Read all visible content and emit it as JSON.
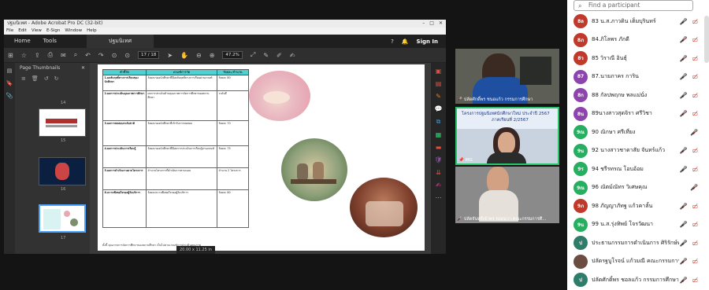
{
  "acrobat": {
    "window_title": "ปฐมนิเทศ - Adobe Acrobat Pro DC (32-bit)",
    "menu": [
      "File",
      "Edit",
      "View",
      "E-Sign",
      "Window",
      "Help"
    ],
    "tabs": {
      "home": "Home",
      "tools": "Tools",
      "doc": "ปฐมนิเทศ"
    },
    "sign_in": "Sign In",
    "page_current": "17",
    "page_total": "/ 18",
    "zoom": "47.2%",
    "panel_title": "Page Thumbnails",
    "thumb_numbers": [
      "14",
      "15",
      "16",
      "17"
    ],
    "page_size": "20.00 x 11.25 in"
  },
  "page_content": {
    "headers": [
      "ตัวชี้วัด",
      "เกณฑ์การวัด",
      "ร้อยละ/จำนวน"
    ],
    "rows": [
      {
        "label": "1.ผลสัมฤทธิ์ทางการเรียนของนักศึกษา",
        "criteria": "ร้อยละของนักศึกษาที่มีผลสัมฤทธิ์ทางการเรียนผ่านเกณฑ์",
        "value": "ร้อยละ 80"
      },
      {
        "label": "2.ผลการประเมินคุณภาพการศึกษา",
        "criteria": "ผลการประเมินด้านคุณภาพการจัดการศึกษาของสถานศึกษา",
        "value": "ระดับดี"
      },
      {
        "label": "3.ผลการทดสอบระดับชาติ",
        "criteria": "ร้อยละของนักศึกษาที่เข้ารับการทดสอบ",
        "value": "ร้อยละ 70"
      },
      {
        "label": "4.ผลการประเมินการเรียนรู้",
        "criteria": "ร้อยละของนักศึกษาที่มีผลการประเมินการเรียนรู้ผ่านเกณฑ์",
        "value": "ร้อยละ 75"
      },
      {
        "label": "5.ผลการดำเนินงานตามโครงการ",
        "criteria": "จำนวนโครงการที่ดำเนินการตามแผน",
        "value": "จำนวน 2 โครงการ"
      },
      {
        "label": "6.ความพึงพอใจของผู้รับบริการ",
        "criteria": "ร้อยละความพึงพอใจของผู้รับบริการ",
        "value": "ร้อยละ 80"
      }
    ],
    "footnote": "ทั้งนี้ คุณภาพการจัดการศึกษาของสถานศึกษา เป็นไปตามเกณฑ์การประเมินคุณภาพ"
  },
  "video_tiles": [
    {
      "name": "ปลัดศักดิ์พร ชนอแก้ว กรรมการศึกษา",
      "muted": true
    },
    {
      "name": "MG",
      "muted": false,
      "slide_title": "โครงการปฐมนิเทศนักศึกษาใหม่ ประจำปี 2567",
      "slide_sub": "ภาคเรียนที่ 2/2567"
    },
    {
      "name": "ปลัดจันทร์เจ้าพร หงอนวา คณะกรรมการศึ...",
      "muted": true
    }
  ],
  "participants_panel": {
    "search_placeholder": "Find a participant",
    "participants": [
      {
        "initials": "8ล",
        "name": "83 น.ส.ภาวดิน  เต็มบุรินทร์",
        "color": "#c0392b"
      },
      {
        "initials": "8ภ",
        "name": "84.ภิโลพร ภักดี",
        "color": "#c0392b"
      },
      {
        "initials": "8ว",
        "name": "85 วิราณี อินธุ์",
        "color": "#c0392b"
      },
      {
        "initials": "87",
        "name": "87.นายภาคร การิน",
        "color": "#8e44ad"
      },
      {
        "initials": "8ก",
        "name": "88 กัลปพฤกษ พลแม่นั่ง",
        "color": "#8e44ad"
      },
      {
        "initials": "8น",
        "name": "89นางสาวสุดจิรา ศรีวิชา",
        "color": "#8e44ad"
      },
      {
        "initials": "9ณ",
        "name": "90 ณิกษา  ศรีเที่ยง",
        "color": "#27ae60"
      },
      {
        "initials": "9น",
        "name": "92 นางสาวชาดาสัย  จันทร์แก้ว",
        "color": "#27ae60"
      },
      {
        "initials": "9ร",
        "name": "94 ชรีรทรณ  โอบอ้อม",
        "color": "#27ae60"
      },
      {
        "initials": "9ณ",
        "name": "96 ณัตม์ณัทร วิเศษคุณ",
        "color": "#27ae60"
      },
      {
        "initials": "9ภ",
        "name": "98 ภัญญาภัทฐ แก้วคาลั้น",
        "color": "#c0392b"
      },
      {
        "initials": "9น",
        "name": "99 น.ส.รุ่งทิพย์  โจรวัฒนา",
        "color": "#27ae60"
      },
      {
        "initials": "ป",
        "name": "ประธานกรรมการดำเนินการ ศิริรักษ์ทดี...",
        "color": "#2e7d6b"
      },
      {
        "initials": "",
        "name": "ปลัดรฐบูโรจน์ แก้วมณี คณะกรรมการ...",
        "color": "#6d4c41"
      },
      {
        "initials": "ป",
        "name": "ปลัดศักดิ์พร ชอลแก้ว กรรมการศึกษา",
        "color": "#2e7d6b"
      }
    ]
  }
}
